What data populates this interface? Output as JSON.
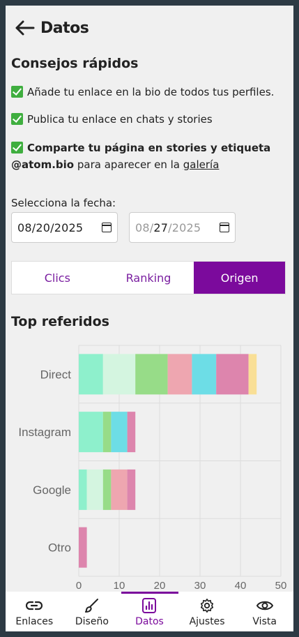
{
  "header": {
    "title": "Datos"
  },
  "tips": {
    "title": "Consejos rápidos",
    "items": [
      {
        "text": "Añade tu enlace en la bio de todos tus perfiles."
      },
      {
        "text": "Publica tu enlace en chats y stories"
      }
    ],
    "item3": {
      "bold": "Comparte tu página en stories y etiqueta @atom.bio",
      "rest": " para aparecer en la ",
      "link": "galería"
    }
  },
  "date": {
    "label": "Selecciona la fecha:",
    "start": "08/20/2025",
    "end_prefix": "08/",
    "end_day": "27",
    "end_suffix": "/2025"
  },
  "tabs": [
    {
      "label": "Clics"
    },
    {
      "label": "Ranking"
    },
    {
      "label": "Origen"
    }
  ],
  "active_tab": "Origen",
  "colors": {
    "accent": "#7b0a9c",
    "segments": [
      "#8ef0cc",
      "#d4f5e0",
      "#97dc88",
      "#eea6b0",
      "#6ddde6",
      "#dd85ad",
      "#f9df96"
    ]
  },
  "chart_data": {
    "type": "bar",
    "title": "Top referidos",
    "orientation": "horizontal",
    "stacked": true,
    "categories": [
      "Direct",
      "Instagram",
      "Google",
      "Otro"
    ],
    "stacks": [
      [
        6,
        8,
        8,
        6,
        6,
        8,
        2
      ],
      [
        6,
        2,
        4,
        2
      ],
      [
        2,
        4,
        2,
        4,
        2
      ],
      [
        2
      ]
    ],
    "stack_colors": [
      [
        0,
        1,
        2,
        3,
        4,
        5,
        6
      ],
      [
        0,
        2,
        4,
        5
      ],
      [
        0,
        1,
        2,
        3,
        5
      ],
      [
        5
      ]
    ],
    "xlim": [
      0,
      50
    ],
    "xticks": [
      0,
      10,
      20,
      30,
      40,
      50
    ],
    "grid": true
  },
  "nav": [
    {
      "label": "Enlaces",
      "icon": "link-icon"
    },
    {
      "label": "Diseño",
      "icon": "brush-icon"
    },
    {
      "label": "Datos",
      "icon": "chart-icon"
    },
    {
      "label": "Ajustes",
      "icon": "gear-icon"
    },
    {
      "label": "Vista",
      "icon": "eye-icon"
    }
  ]
}
